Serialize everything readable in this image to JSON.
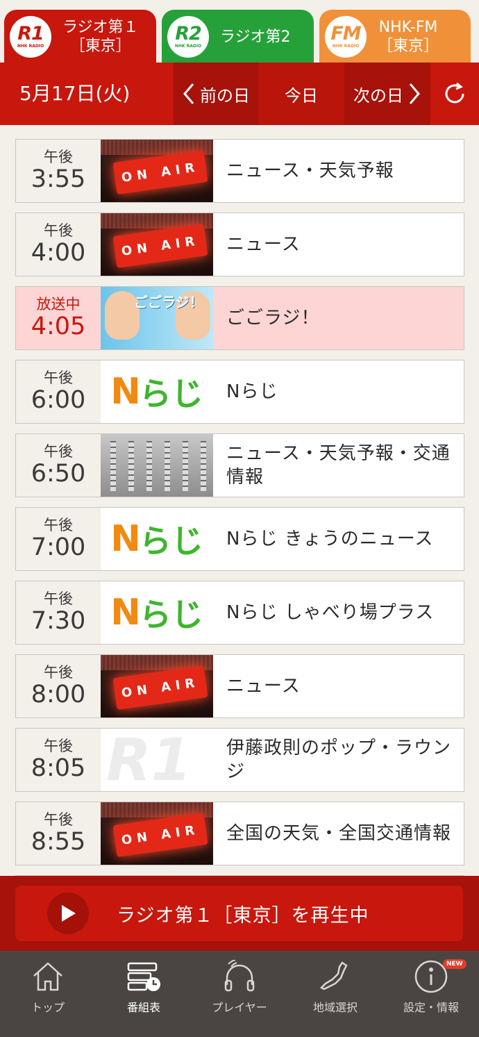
{
  "channel_tabs": [
    {
      "logo": "R1",
      "logo_sub": "NHK RADIO",
      "label": "ラジオ第１\n［東京］",
      "color": "#c8170d",
      "active": true
    },
    {
      "logo": "R2",
      "logo_sub": "NHK RADIO",
      "label": "ラジオ第2",
      "color": "#26a13a",
      "active": false
    },
    {
      "logo": "FM",
      "logo_sub": "NHK RADIO",
      "label": "NHK-FM\n［東京］",
      "color": "#f0913a",
      "active": false
    }
  ],
  "date_bar": {
    "date": "5月17日(火)",
    "prev_label": "前の日",
    "today_label": "今日",
    "next_label": "次の日",
    "prev_icon": "chevron-left-icon",
    "next_icon": "chevron-right-icon",
    "reload_icon": "reload-icon"
  },
  "programs": [
    {
      "ampm": "午後",
      "time": "3:55",
      "title": "ニュース・天気予報",
      "thumb": "onair"
    },
    {
      "ampm": "午後",
      "time": "4:00",
      "title": "ニュース",
      "thumb": "onair"
    },
    {
      "ampm": "放送中",
      "time": "4:05",
      "title": "ごごラジ！",
      "thumb": "gogo",
      "live": true
    },
    {
      "ampm": "午後",
      "time": "6:00",
      "title": "Nらじ",
      "thumb": "nrj"
    },
    {
      "ampm": "午後",
      "time": "6:50",
      "title": "ニュース・天気予報・交通情報",
      "thumb": "console"
    },
    {
      "ampm": "午後",
      "time": "7:00",
      "title": "Nらじ きょうのニュース",
      "thumb": "nrj"
    },
    {
      "ampm": "午後",
      "time": "7:30",
      "title": "Nらじ しゃべり場プラス",
      "thumb": "nrj"
    },
    {
      "ampm": "午後",
      "time": "8:00",
      "title": "ニュース",
      "thumb": "onair"
    },
    {
      "ampm": "午後",
      "time": "8:05",
      "title": "伊藤政則のポップ・ラウンジ",
      "thumb": "r1"
    },
    {
      "ampm": "午後",
      "time": "8:55",
      "title": "全国の天気・全国交通情報",
      "thumb": "onair"
    }
  ],
  "thumb_text": {
    "onair": "ON AIR",
    "nrj_n": "N",
    "nrj_r": "らじ",
    "gogo": "ごごラジ！",
    "r1": "R1"
  },
  "now_playing": {
    "text": "ラジオ第１［東京］を再生中",
    "icon": "play-icon"
  },
  "bottom_nav": [
    {
      "label": "トップ",
      "icon": "home-icon",
      "active": false
    },
    {
      "label": "番組表",
      "icon": "schedule-icon",
      "active": true
    },
    {
      "label": "プレイヤー",
      "icon": "headphones-icon",
      "active": false
    },
    {
      "label": "地域選択",
      "icon": "japan-map-icon",
      "active": false
    },
    {
      "label": "設定・情報",
      "icon": "settings-info-icon",
      "active": false,
      "badge": "NEW"
    }
  ]
}
